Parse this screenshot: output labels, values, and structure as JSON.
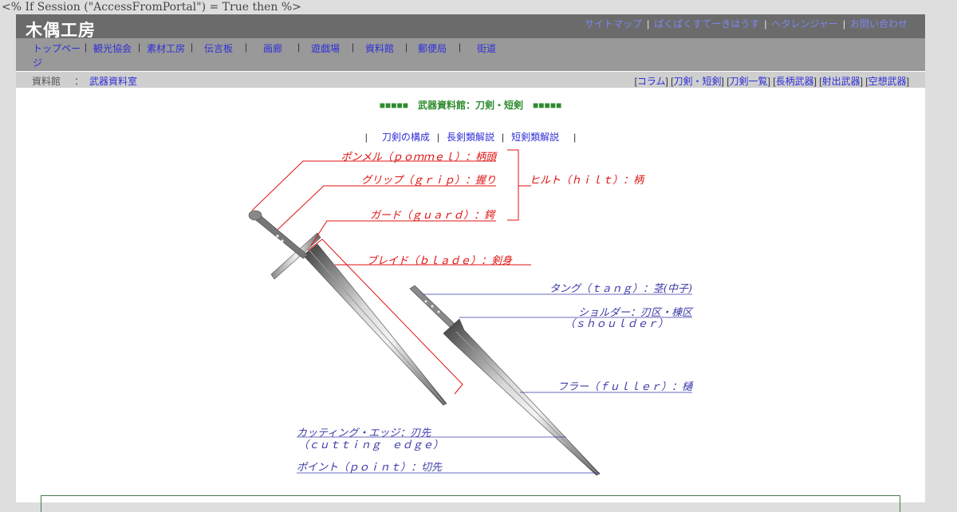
{
  "asp_line": "<% If Session (\"AccessFromPortal\") = True then %>",
  "header": {
    "logo": "木偶工房",
    "top_links": [
      "サイトマップ",
      "ぱくぱくすてーきはうす",
      "ヘタレンジャー",
      "お問い合わせ"
    ]
  },
  "nav": {
    "items": [
      "トップページ",
      "観光協会",
      "素材工房",
      "伝言板",
      "画廊",
      "遊戯場",
      "資料館",
      "郵便局",
      "街道"
    ]
  },
  "breadcrumb": {
    "label": "資料館",
    "colon": "：",
    "link": "武器資料室"
  },
  "categories": [
    "コラム",
    "刀剣・短剣",
    "刀剣一覧",
    "長柄武器",
    "射出武器",
    "空想武器"
  ],
  "page": {
    "title": "■■■■■　武器資料館：刀剣・短剣　■■■■■",
    "subnav": [
      "刀剣の構成",
      "長剣類解説",
      "短剣類解説"
    ]
  },
  "diagram": {
    "labels_red": {
      "pommel": "ポンメル（ｐｏｍｍｅｌ）：柄頭",
      "grip": "グリップ（ｇｒｉｐ）：握り",
      "guard": "ガード（ｇｕａｒｄ）：鍔",
      "hilt": "ヒルト（ｈｉｌｔ）：柄",
      "blade": "ブレイド（ｂｌａｄｅ）：剣身"
    },
    "labels_blue": {
      "tang": "タング（ｔａｎｇ）：茎(中子)",
      "shoulder_1": "ショルダー：刃区・棟区",
      "shoulder_2": "（ｓｈｏｕｌｄｅｒ）",
      "fuller": "フラー（ｆｕｌｌｅｒ）：樋",
      "cutting_1": "カッティング・エッジ：刃先",
      "cutting_2": "（ｃｕｔｔｉｎｇ　ｅｄｇｅ）",
      "point": "ポイント（ｐｏｉｎｔ）：切先"
    },
    "colors": {
      "red": "#e01010",
      "blue": "#3a3aa8"
    }
  }
}
